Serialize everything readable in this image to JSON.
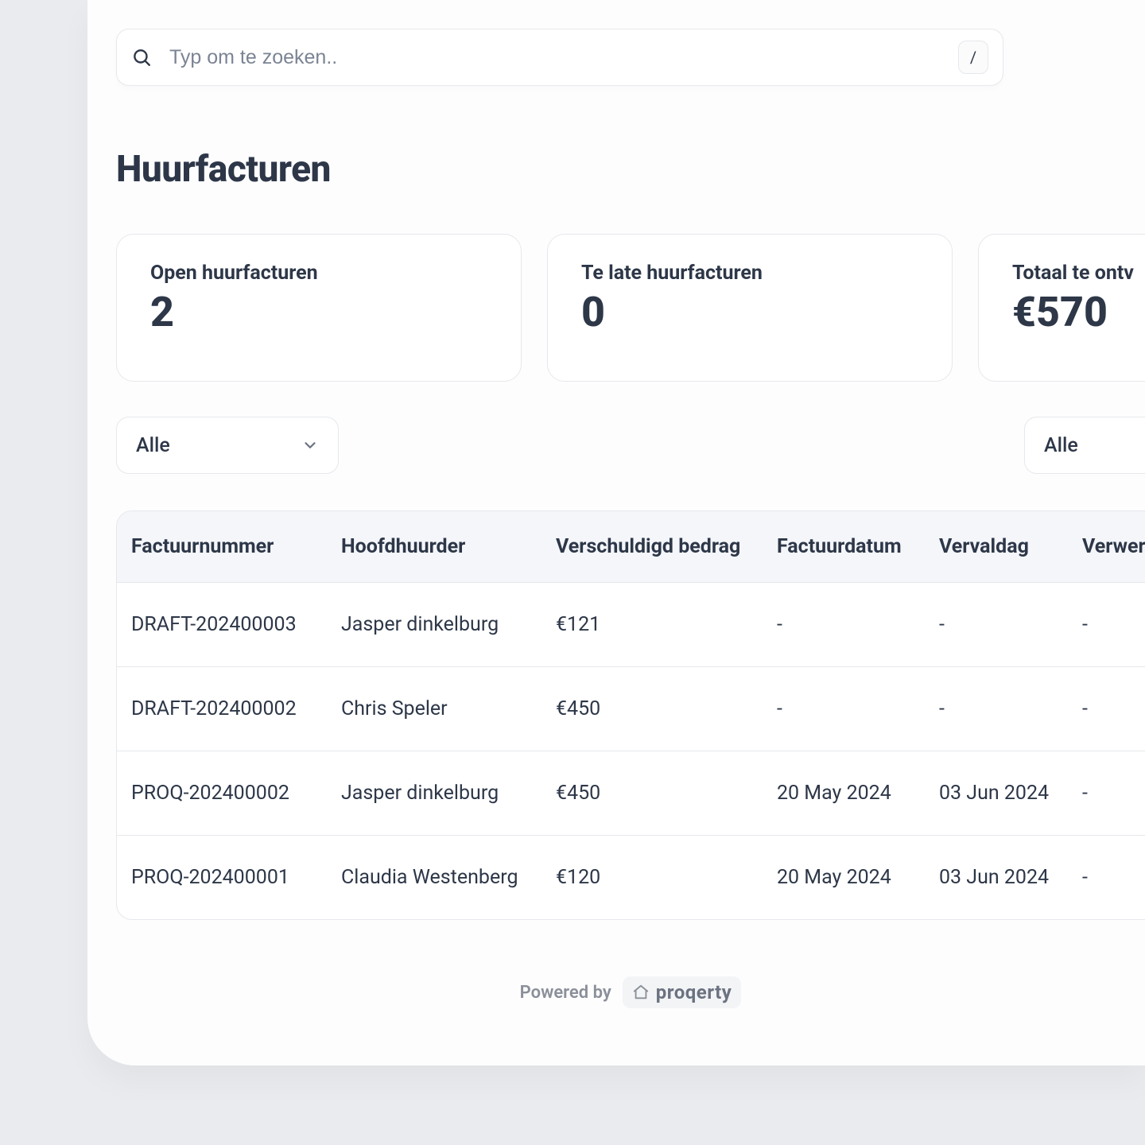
{
  "search": {
    "placeholder": "Typ om te zoeken..",
    "shortcut": "/"
  },
  "page": {
    "title": "Huurfacturen"
  },
  "stats": [
    {
      "title": "Open huurfacturen",
      "value": "2"
    },
    {
      "title": "Te late huurfacturen",
      "value": "0"
    },
    {
      "title": "Totaal te ontv",
      "value": "€570"
    }
  ],
  "filters": {
    "left": "Alle",
    "right": "Alle"
  },
  "table": {
    "headers": {
      "invoice": "Factuurnummer",
      "tenant": "Hoofdhuurder",
      "amount": "Verschuldigd bedrag",
      "invdate": "Factuurdatum",
      "duedate": "Vervaldag",
      "process": "Verwer"
    },
    "rows": [
      {
        "invoice": "DRAFT-202400003",
        "tenant": "Jasper dinkelburg",
        "amount": "€121",
        "invdate": "-",
        "duedate": "-",
        "process": "-"
      },
      {
        "invoice": "DRAFT-202400002",
        "tenant": "Chris Speler",
        "amount": "€450",
        "invdate": "-",
        "duedate": "-",
        "process": "-"
      },
      {
        "invoice": "PROQ-202400002",
        "tenant": "Jasper dinkelburg",
        "amount": "€450",
        "invdate": "20 May 2024",
        "duedate": "03 Jun 2024",
        "process": "-"
      },
      {
        "invoice": "PROQ-202400001",
        "tenant": "Claudia Westenberg",
        "amount": "€120",
        "invdate": "20 May 2024",
        "duedate": "03 Jun 2024",
        "process": "-"
      }
    ]
  },
  "footer": {
    "powered": "Powered by",
    "brand": "proqerty"
  }
}
